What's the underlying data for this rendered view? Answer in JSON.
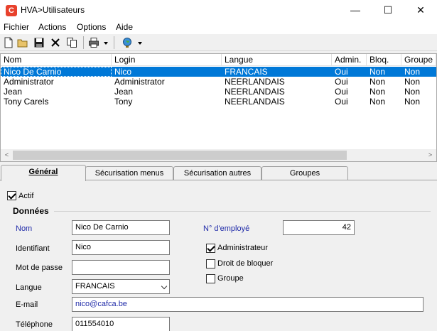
{
  "window": {
    "app_icon": "C",
    "title": "HVA>Utilisateurs",
    "min_glyph": "—",
    "max_glyph": "☐",
    "close_glyph": "✕"
  },
  "menu": [
    "Fichier",
    "Actions",
    "Options",
    "Aide"
  ],
  "toolbar": {
    "icons": [
      "new-document-icon",
      "open-folder-icon",
      "save-icon",
      "delete-icon",
      "copy-icon",
      "print-icon",
      "globe-icon"
    ]
  },
  "list": {
    "columns": [
      "Nom",
      "Login",
      "Langue",
      "Admin.",
      "Bloq.",
      "Groupe"
    ],
    "rows": [
      [
        "Nico De Carnio",
        "Nico",
        "FRANCAIS",
        "Oui",
        "Non",
        "Non"
      ],
      [
        "Administrator",
        "Administrator",
        "NEERLANDAIS",
        "Oui",
        "Non",
        "Non"
      ],
      [
        "Jean",
        "Jean",
        "NEERLANDAIS",
        "Oui",
        "Non",
        "Non"
      ],
      [
        "Tony Carels",
        "Tony",
        "NEERLANDAIS",
        "Oui",
        "Non",
        "Non"
      ]
    ],
    "selected_index": 0,
    "scroll_left": "<",
    "scroll_right": ">"
  },
  "tabs": [
    "Général",
    "Sécurisation menus",
    "Sécurisation autres",
    "Groupes"
  ],
  "form": {
    "actif_label": "Actif",
    "actif_checked": true,
    "group_title": "Données",
    "nom_label": "Nom",
    "nom_value": "Nico De Carnio",
    "identifiant_label": "Identifiant",
    "identifiant_value": "Nico",
    "mot_de_passe_label": "Mot de passe",
    "mot_de_passe_value": "",
    "langue_label": "Langue",
    "langue_value": "FRANCAIS",
    "email_label": "E-mail",
    "email_value": "nico@cafca.be",
    "telephone_label": "Téléphone",
    "telephone_value": "011554010",
    "employe_label": "N° d'employé",
    "employe_value": "42",
    "administrateur_label": "Administrateur",
    "administrateur_checked": true,
    "droit_bloquer_label": "Droit de bloquer",
    "droit_bloquer_checked": false,
    "groupe_label": "Groupe",
    "groupe_checked": false
  },
  "colors": {
    "selection": "#0078d7",
    "label_blue": "#1f2aa8",
    "app_icon": "#e8412c"
  }
}
